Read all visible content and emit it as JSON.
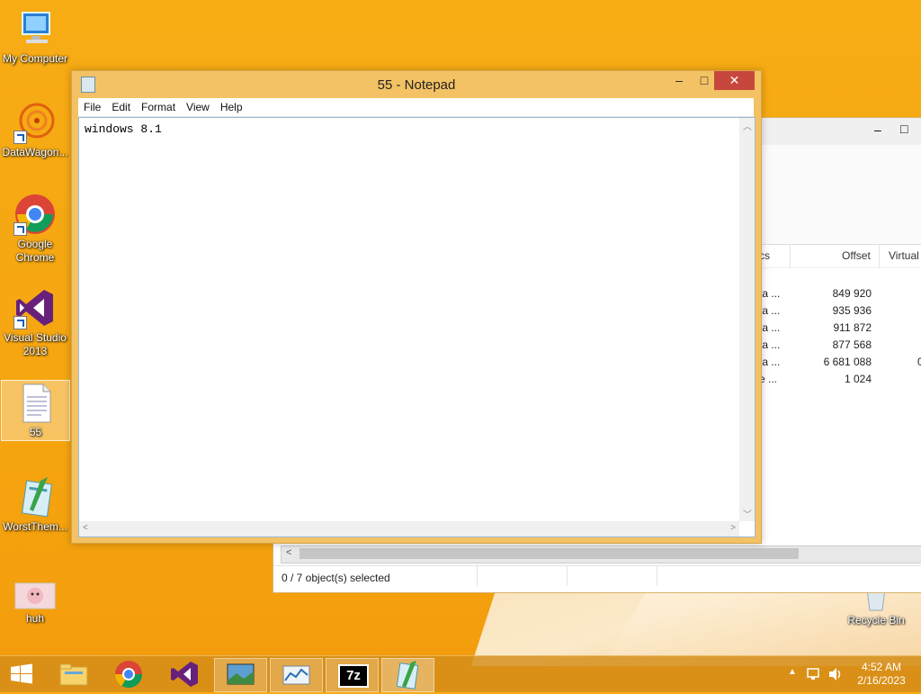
{
  "desktop": {
    "icons": [
      {
        "label": "My Computer"
      },
      {
        "label": "DataWagon..."
      },
      {
        "label": "Google Chrome"
      },
      {
        "label": "Visual Studio 2013"
      },
      {
        "label": "55"
      },
      {
        "label": "WorstThem..."
      },
      {
        "label": "huh"
      },
      {
        "label": "Recycle Bin"
      }
    ]
  },
  "background_window": {
    "columns": [
      "cs",
      "Offset",
      "Virtual"
    ],
    "rows": [
      {
        "col0": "ta ...",
        "offset": "849 920",
        "virtual": ""
      },
      {
        "col0": "ta ...",
        "offset": "935 936",
        "virtual": ""
      },
      {
        "col0": "ta ...",
        "offset": "911 872",
        "virtual": ""
      },
      {
        "col0": "ta ...",
        "offset": "877 568",
        "virtual": ""
      },
      {
        "col0": "ta ...",
        "offset": "6 681 088",
        "virtual": "0"
      },
      {
        "col0": "e ...",
        "offset": "1 024",
        "virtual": ""
      }
    ],
    "status_text": "0 / 7 object(s) selected",
    "controls": {
      "minimize": "–",
      "maximize": "□"
    }
  },
  "notepad": {
    "title": "55 - Notepad",
    "menu": [
      "File",
      "Edit",
      "Format",
      "View",
      "Help"
    ],
    "content": "windows 8.1",
    "controls": {
      "minimize": "–",
      "maximize": "□",
      "close": "✕"
    }
  },
  "taskbar": {
    "clock_time": "4:52 AM",
    "clock_date": "2/16/2023",
    "sevenzip_label": "7z",
    "colors": {
      "accent": "#d48d19",
      "close_red": "#c7473c"
    }
  }
}
